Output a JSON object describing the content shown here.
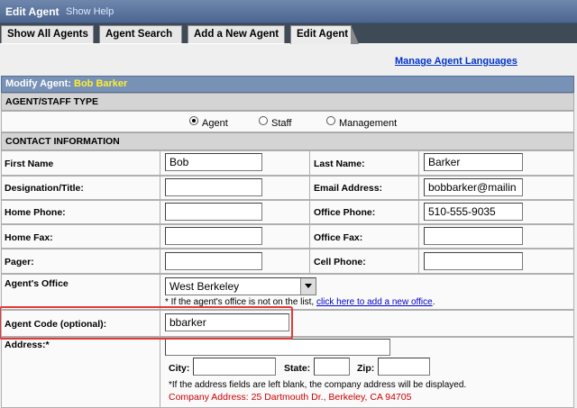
{
  "window": {
    "title": "Edit Agent",
    "help_link": "Show Help"
  },
  "tabs": [
    {
      "label": "Show All Agents",
      "active": false
    },
    {
      "label": "Agent Search",
      "active": false
    },
    {
      "label": "Add a New Agent",
      "active": false
    },
    {
      "label": "Edit Agent",
      "active": true
    }
  ],
  "manage_link": "Manage Agent Languages",
  "modify": {
    "label": "Modify Agent:",
    "name": "Bob Barker"
  },
  "agent_type": {
    "header": "AGENT/STAFF TYPE",
    "options": [
      "Agent",
      "Staff",
      "Management"
    ],
    "selected": "Agent"
  },
  "contact": {
    "header": "CONTACT INFORMATION",
    "first_name_label": "First Name",
    "first_name": "Bob",
    "last_name_label": "Last Name:",
    "last_name": "Barker",
    "designation_label": "Designation/Title:",
    "designation": "",
    "email_label": "Email Address:",
    "email": "bobbarker@mailin",
    "home_phone_label": "Home Phone:",
    "home_phone": "",
    "office_phone_label": "Office Phone:",
    "office_phone": "510-555-9035",
    "home_fax_label": "Home Fax:",
    "home_fax": "",
    "office_fax_label": "Office Fax:",
    "office_fax": "",
    "pager_label": "Pager:",
    "pager": "",
    "cell_label": "Cell Phone:",
    "cell": ""
  },
  "office": {
    "label": "Agent's Office",
    "selected": "West Berkeley",
    "note_prefix": "* If the agent's office is not on the list,",
    "note_link": "click here to add a new office",
    "note_suffix": "."
  },
  "agent_code": {
    "label": "Agent Code (optional):",
    "value": "bbarker"
  },
  "address": {
    "label": "Address:*",
    "street": "",
    "city_label": "City:",
    "city": "",
    "state_label": "State:",
    "state": "",
    "zip_label": "Zip:",
    "zip": "",
    "note": "*If the address fields are left blank, the company address will be displayed.",
    "company_address": "Company Address: 25 Dartmouth Dr., Berkeley, CA 94705"
  },
  "colors": {
    "title_bar": "#5a7198",
    "accent_name": "#ffee33",
    "highlight": "#e03a3a",
    "link": "#0033cc"
  }
}
